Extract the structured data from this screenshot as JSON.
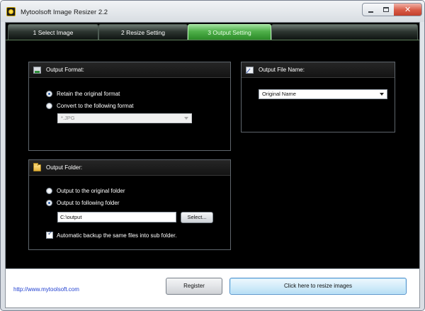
{
  "window": {
    "title": "Mytoolsoft Image Resizer 2.2",
    "controls": {
      "minimize": "minimize",
      "maximize": "maximize",
      "close": "✕"
    }
  },
  "tabs": [
    {
      "label": "1 Select Image",
      "active": false
    },
    {
      "label": "2 Resize Setting",
      "active": false
    },
    {
      "label": "3 Output Setting",
      "active": true
    },
    {
      "label": "",
      "active": false
    }
  ],
  "output_format": {
    "title": "Output Format:",
    "options": [
      {
        "label": "Retain the original format",
        "checked": true
      },
      {
        "label": "Convert to the following format",
        "checked": false
      }
    ],
    "format_select": {
      "value": "*.JPG",
      "enabled": false
    }
  },
  "output_folder": {
    "title": "Output Folder:",
    "options": [
      {
        "label": "Output to the original folder",
        "checked": false
      },
      {
        "label": "Output to following folder",
        "checked": true
      }
    ],
    "folder_path": "C:\\output",
    "select_button": "Select...",
    "backup_checkbox": {
      "label": "Automatic backup the same files into sub folder.",
      "checked": true
    }
  },
  "output_file_name": {
    "title": "Output File Name:",
    "name_select": {
      "value": "Original Name"
    }
  },
  "footer": {
    "link": "http://www.mytoolsoft.com",
    "register_button": "Register",
    "resize_button": "Click here to resize images"
  },
  "colors": {
    "active_tab": "#4fb04a",
    "panel_background": "#000000",
    "link": "#1f3fd0"
  }
}
